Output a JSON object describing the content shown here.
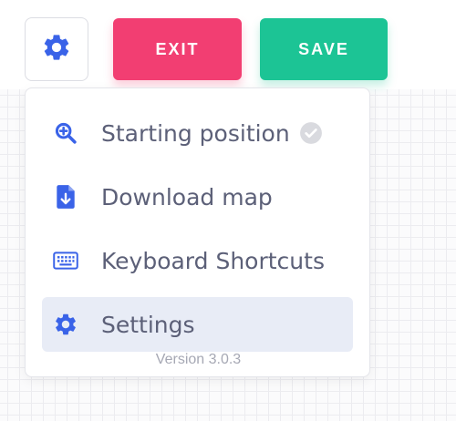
{
  "toolbar": {
    "settings_icon": "gear-icon",
    "exit_label": "EXIT",
    "save_label": "SAVE"
  },
  "menu": {
    "items": [
      {
        "label": "Starting position",
        "icon": "zoom-in-icon",
        "status_icon": "check-circle-icon"
      },
      {
        "label": "Download map",
        "icon": "file-download-icon"
      },
      {
        "label": "Keyboard Shortcuts",
        "icon": "keyboard-icon"
      },
      {
        "label": "Settings",
        "icon": "gear-icon",
        "active": true
      }
    ],
    "version": "Version 3.0.3"
  },
  "colors": {
    "accent_blue": "#3a63e8",
    "exit_pink": "#f23e72",
    "save_green": "#1cc495",
    "menu_text": "#5c6078",
    "active_bg": "#e8ecf6"
  }
}
